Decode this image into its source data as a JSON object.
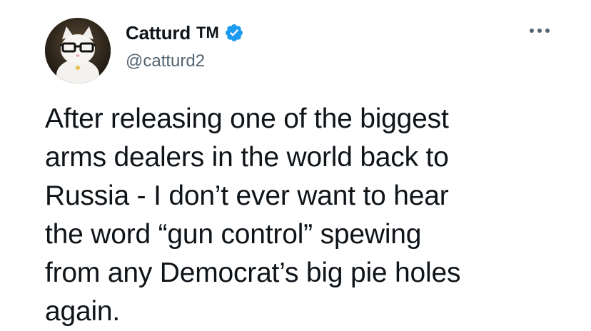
{
  "author": {
    "display_name": "Catturd",
    "badge_text": "TM",
    "verified_icon": "verified-badge-icon",
    "handle": "@catturd2",
    "avatar_icon": "cat-with-glasses-avatar"
  },
  "actions": {
    "more_icon": "more-options-icon"
  },
  "tweet": {
    "text": "After releasing one of the biggest\narms dealers in the world back to\nRussia - I don’t ever want to hear\nthe word “gun control” spewing\nfrom any Democrat’s big pie holes\nagain."
  },
  "colors": {
    "verified_blue": "#1d9bf0",
    "handle_gray": "#536471",
    "text": "#0f1419"
  }
}
